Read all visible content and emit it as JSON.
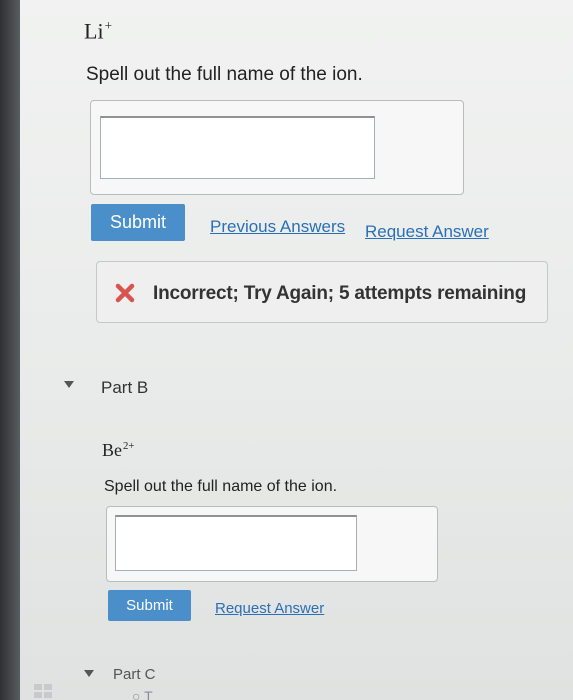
{
  "part_a": {
    "formula_base": "Li",
    "formula_charge": "+",
    "prompt": "Spell out the full name of the ion.",
    "answer_value": "",
    "submit_label": "Submit",
    "previous_answers_label": "Previous Answers",
    "request_answer_label": "Request Answer",
    "feedback": {
      "icon": "x-mark-icon",
      "text": "Incorrect; Try Again; 5 attempts remaining",
      "icon_color": "#d9534f"
    }
  },
  "part_b": {
    "header": "Part B",
    "formula_base": "Be",
    "formula_charge": "2+",
    "prompt": "Spell out the full name of the ion.",
    "answer_value": "",
    "submit_label": "Submit",
    "request_answer_label": "Request Answer"
  },
  "part_c": {
    "header": "Part C",
    "partial_text": "○ T"
  },
  "colors": {
    "accent": "#4a8fc9",
    "link": "#2b6fb6",
    "error": "#d9534f"
  }
}
